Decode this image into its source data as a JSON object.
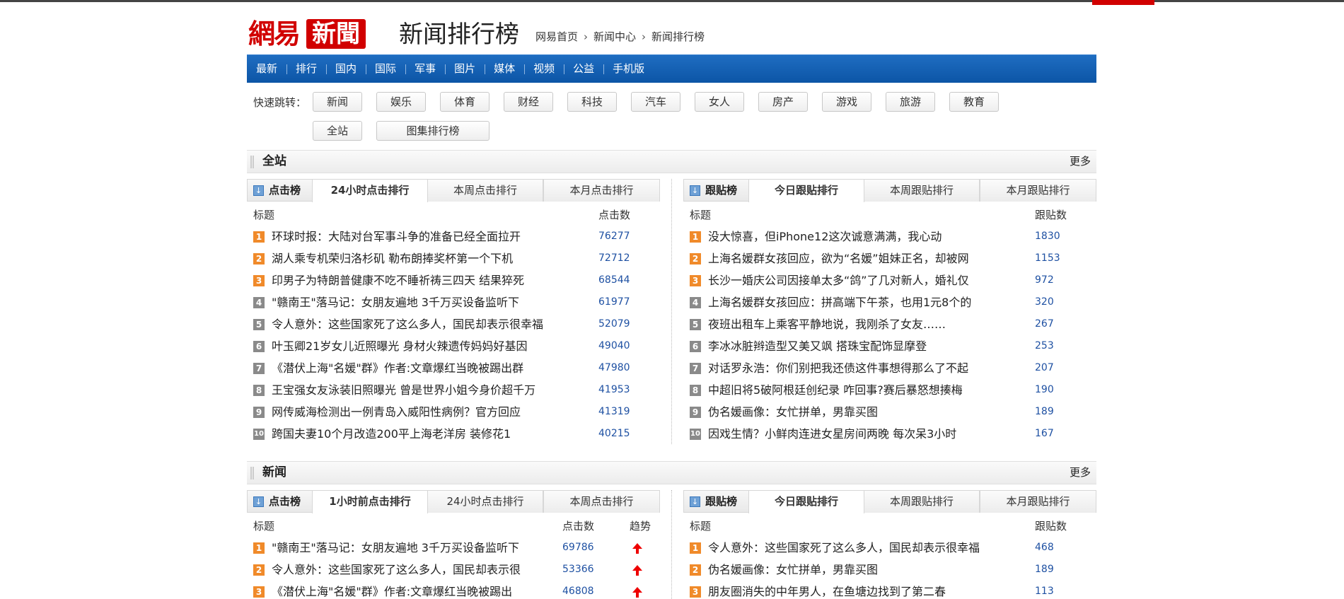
{
  "logo": {
    "wangyi": "網易",
    "xinwen": "新聞"
  },
  "page_title": "新闻排行榜",
  "breadcrumb": [
    "网易首页",
    "新闻中心",
    "新闻排行榜"
  ],
  "nav": [
    "最新",
    "排行",
    "国内",
    "国际",
    "军事",
    "图片",
    "媒体",
    "视频",
    "公益",
    "手机版"
  ],
  "quick": {
    "label": "快速跳转：",
    "row1": [
      "新闻",
      "娱乐",
      "体育",
      "财经",
      "科技",
      "汽车",
      "女人",
      "房产",
      "游戏",
      "旅游",
      "教育"
    ],
    "row2": [
      "全站",
      "图集排行榜"
    ]
  },
  "sections": [
    {
      "title": "全站",
      "more": "更多",
      "click": {
        "lead": "点击榜",
        "tabs": [
          "24小时点击排行",
          "本周点击排行",
          "本月点击排行"
        ],
        "col_title": "标题",
        "col_num": "点击数",
        "rows": [
          {
            "rank": "1",
            "title": "环球时报：大陆对台军事斗争的准备已经全面拉开",
            "num": "76277"
          },
          {
            "rank": "2",
            "title": "湖人乘专机荣归洛杉矶 勒布朗捧奖杯第一个下机",
            "num": "72712"
          },
          {
            "rank": "3",
            "title": "印男子为特朗普健康不吃不睡祈祷三四天 结果猝死",
            "num": "68544"
          },
          {
            "rank": "4",
            "title": "\"赣南王\"落马记：女朋友遍地 3千万买设备监听下",
            "num": "61977"
          },
          {
            "rank": "5",
            "title": "令人意外：这些国家死了这么多人，国民却表示很幸福",
            "num": "52079"
          },
          {
            "rank": "6",
            "title": "叶玉卿21岁女儿近照曝光 身材火辣遗传妈妈好基因",
            "num": "49040"
          },
          {
            "rank": "7",
            "title": "《潜伏上海\"名媛\"群》作者:文章爆红当晚被踢出群",
            "num": "47980"
          },
          {
            "rank": "8",
            "title": "王宝强女友泳装旧照曝光 曾是世界小姐今身价超千万",
            "num": "41953"
          },
          {
            "rank": "9",
            "title": "网传威海检测出一例青岛入威阳性病例？官方回应",
            "num": "41319"
          },
          {
            "rank": "10",
            "title": "跨国夫妻10个月改造200平上海老洋房 装修花1",
            "num": "40215"
          }
        ]
      },
      "follow": {
        "lead": "跟贴榜",
        "tabs": [
          "今日跟贴排行",
          "本周跟贴排行",
          "本月跟贴排行"
        ],
        "col_title": "标题",
        "col_num": "跟贴数",
        "rows": [
          {
            "rank": "1",
            "title": "没大惊喜，但iPhone12这次诚意满满，我心动",
            "num": "1830"
          },
          {
            "rank": "2",
            "title": "上海名媛群女孩回应，欲为“名媛”姐妹正名，却被网",
            "num": "1153"
          },
          {
            "rank": "3",
            "title": "长沙一婚庆公司因接单太多“鸽”了几对新人，婚礼仅",
            "num": "972"
          },
          {
            "rank": "4",
            "title": "上海名媛群女孩回应：拼高端下午茶，也用1元8个的",
            "num": "320"
          },
          {
            "rank": "5",
            "title": "夜班出租车上乘客平静地说，我刚杀了女友……",
            "num": "267"
          },
          {
            "rank": "6",
            "title": "李冰冰脏辫造型又美又飒 搭珠宝配饰显摩登",
            "num": "253"
          },
          {
            "rank": "7",
            "title": "对话罗永浩：你们别把我还债这件事想得那么了不起",
            "num": "207"
          },
          {
            "rank": "8",
            "title": "中超旧将5破阿根廷创纪录 咋回事?赛后暴怒想揍梅",
            "num": "190"
          },
          {
            "rank": "9",
            "title": "伪名媛画像：女忙拼单，男靠买图",
            "num": "189"
          },
          {
            "rank": "10",
            "title": "因戏生情？小鲜肉连进女星房间两晚 每次呆3小时",
            "num": "167"
          }
        ]
      }
    },
    {
      "title": "新闻",
      "more": "更多",
      "click": {
        "lead": "点击榜",
        "tabs": [
          "1小时前点击排行",
          "24小时点击排行",
          "本周点击排行"
        ],
        "col_title": "标题",
        "col_num": "点击数",
        "col_trend": "趋势",
        "rows": [
          {
            "rank": "1",
            "title": "\"赣南王\"落马记：女朋友遍地 3千万买设备监听下",
            "num": "69786",
            "trend": "up"
          },
          {
            "rank": "2",
            "title": "令人意外：这些国家死了这么多人，国民却表示很",
            "num": "53366",
            "trend": "up"
          },
          {
            "rank": "3",
            "title": "《潜伏上海\"名媛\"群》作者:文章爆红当晚被踢出",
            "num": "46808",
            "trend": "up"
          }
        ]
      },
      "follow": {
        "lead": "跟贴榜",
        "tabs": [
          "今日跟贴排行",
          "本周跟贴排行",
          "本月跟贴排行"
        ],
        "col_title": "标题",
        "col_num": "跟贴数",
        "rows": [
          {
            "rank": "1",
            "title": "令人意外：这些国家死了这么多人，国民却表示很幸福",
            "num": "468"
          },
          {
            "rank": "2",
            "title": "伪名媛画像：女忙拼单，男靠买图",
            "num": "189"
          },
          {
            "rank": "3",
            "title": "朋友圈消失的中年男人，在鱼塘边找到了第二春",
            "num": "113"
          }
        ]
      }
    }
  ],
  "colors": {
    "brand_red": "#d10000",
    "nav_blue": "#0c55a6",
    "rank_hot": "#f08a2a",
    "rank_cold": "#8a8a8a",
    "number_blue": "#1e50a2",
    "trend_up": "#e00000"
  }
}
